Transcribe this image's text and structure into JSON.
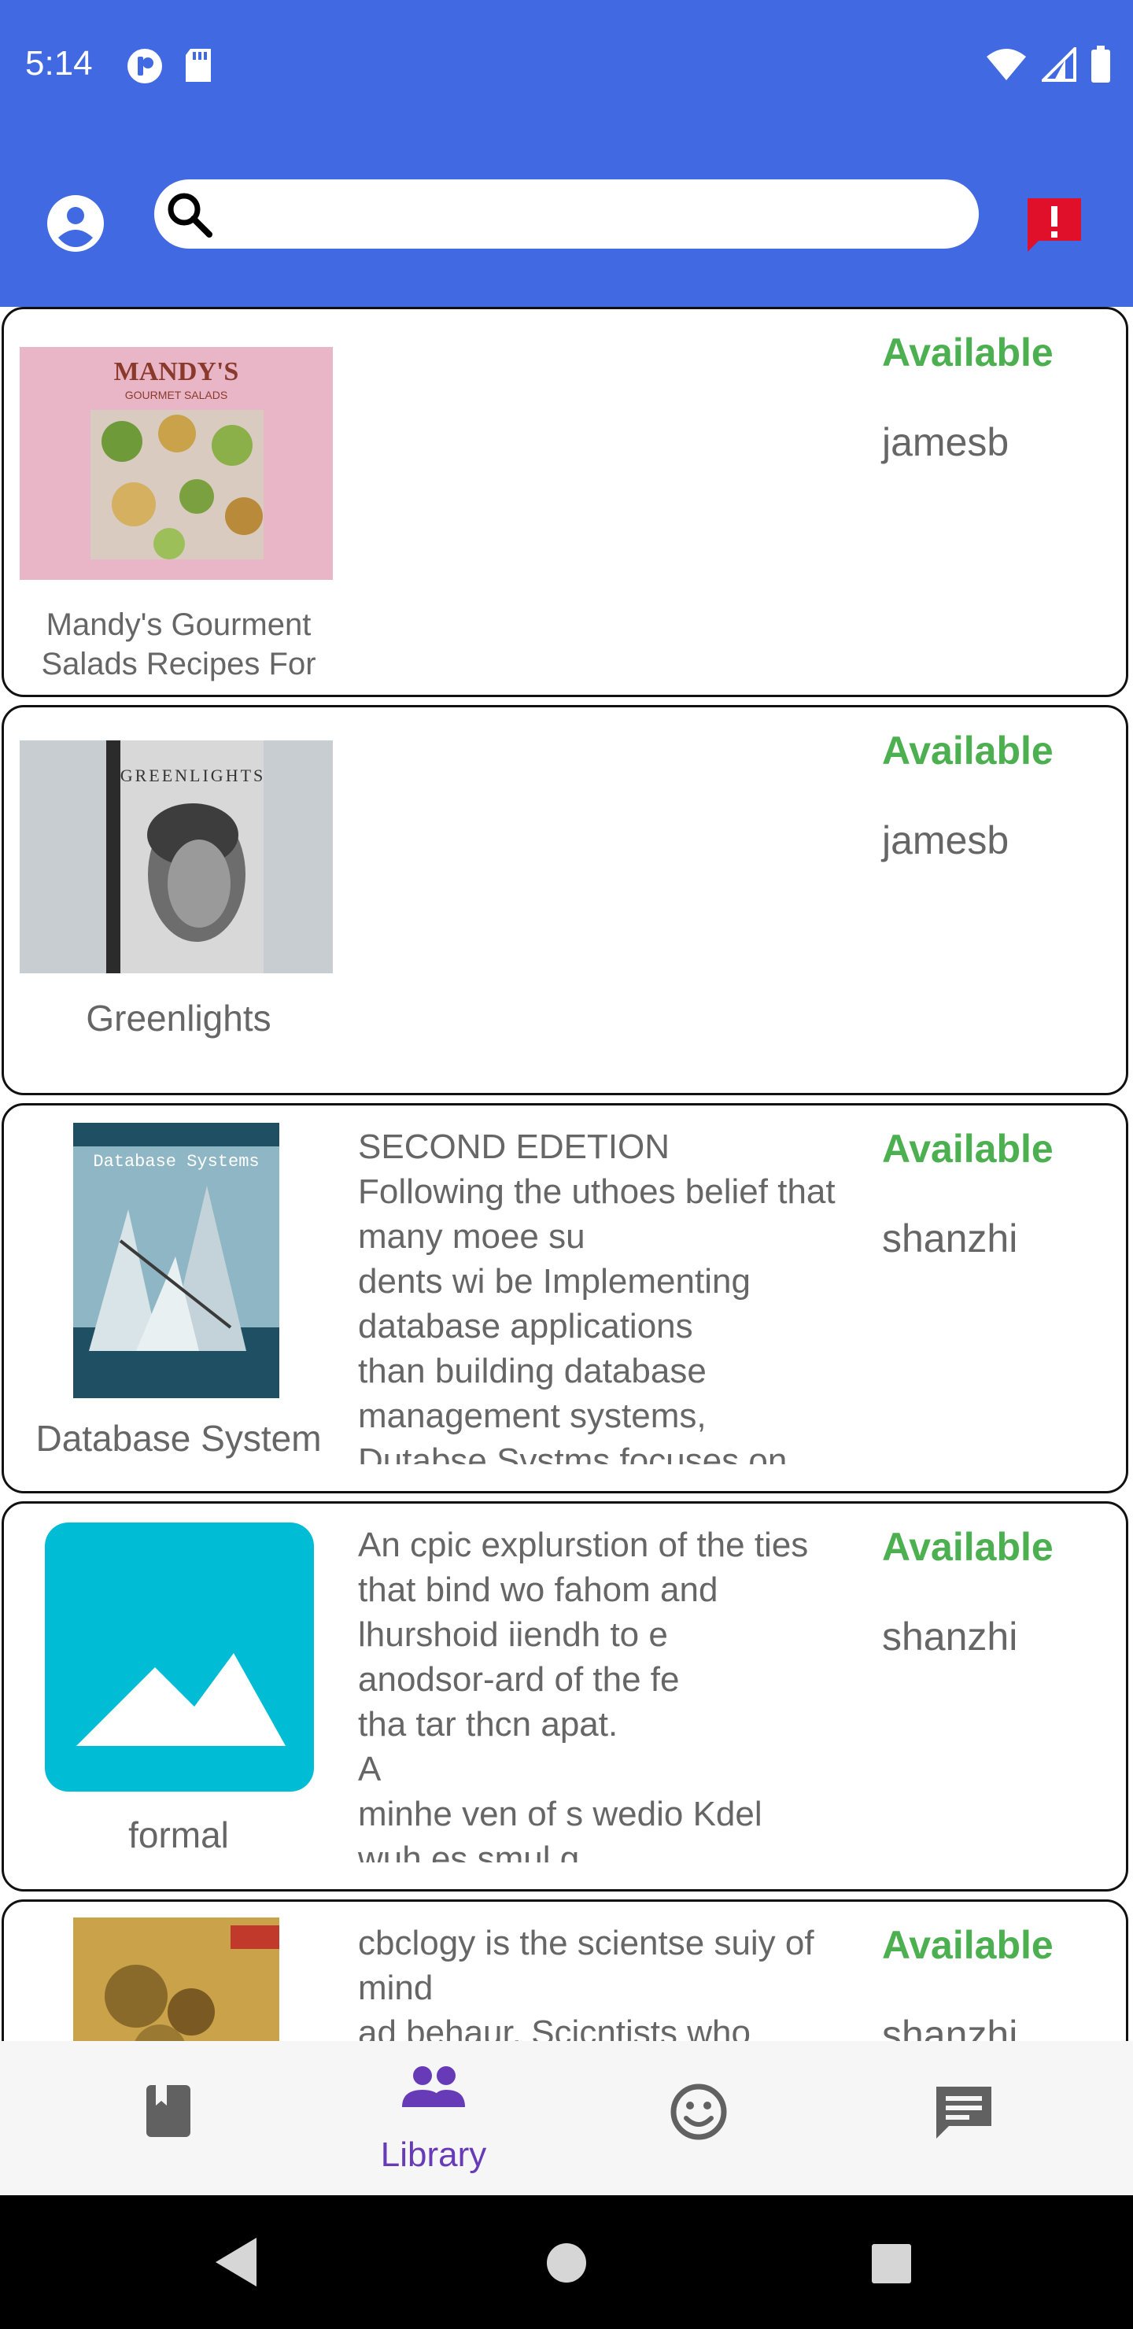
{
  "status_bar": {
    "time": "5:14"
  },
  "app_bar": {
    "search_placeholder": "",
    "account_icon": "account-circle-icon",
    "report_icon": "feedback-icon"
  },
  "colors": {
    "primary": "#4169e1",
    "status_available": "#4caf50",
    "nav_selected": "#673ab7",
    "report_red": "#e0102a"
  },
  "books": [
    {
      "title": "Mandy's Gourment Salads Recipes For",
      "description": "",
      "status": "Available",
      "owner": "jamesb"
    },
    {
      "title": "Greenlights",
      "description": "",
      "status": "Available",
      "owner": "jamesb"
    },
    {
      "title": "Database System",
      "description": "SECOND EDETION\nFollowing the uthoes belief that many moee su\ndents wi be Implementing database applications\nthan building database management systems,\nDutabse Svstms focuses on",
      "status": "Available",
      "owner": "shanzhi"
    },
    {
      "title": "formal",
      "description": "An cpic explurstion of the ties that bind wo fahom and lhurshoid iiendh to e\nanodsor-ard of the fe\ntha tar thcn apat.\nA\nminhe ven of s wedio Kdel\nwuh,es smul g",
      "status": "Available",
      "owner": "shanzhi"
    },
    {
      "title": "",
      "description": "cbclogy is the scientse suiy of mind\nad behaur. Scicntists who",
      "status": "Available",
      "owner": "shanzhi"
    }
  ],
  "bottom_nav": [
    {
      "label": "",
      "icon": "book-icon"
    },
    {
      "label": "Library",
      "icon": "people-icon"
    },
    {
      "label": "",
      "icon": "smiley-icon"
    },
    {
      "label": "",
      "icon": "chat-icon"
    }
  ]
}
